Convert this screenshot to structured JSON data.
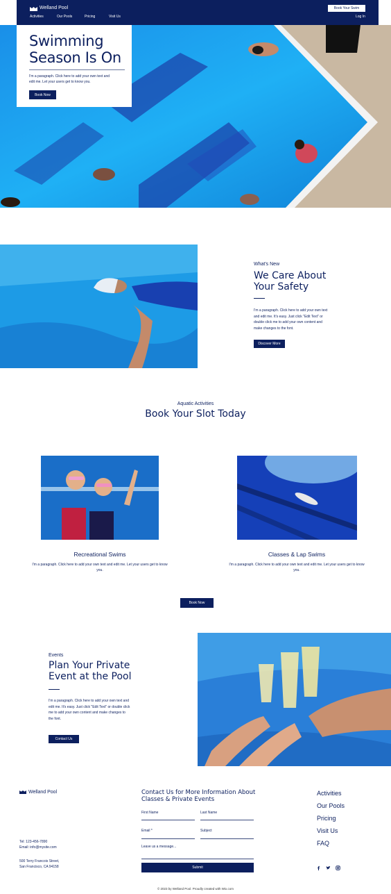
{
  "header": {
    "logo_text": "Welland Pool",
    "nav": [
      "Activities",
      "Our Pools",
      "Pricing",
      "Visit Us"
    ],
    "cta": "Book Your Swim",
    "login": "Log In"
  },
  "hero": {
    "title": "Swimming Season Is On",
    "paragraph": "I'm a paragraph. Click here to add your own text and edit me. Let your users get to know you.",
    "button": "Book Now"
  },
  "safety": {
    "eyebrow": "What's New",
    "title": "We Care About Your Safety",
    "paragraph": "I'm a paragraph. Click here to add your own text and edit me. It's easy. Just click \"Edit Text\" or double click me to add your own content and make changes to the font.",
    "button": "Discover More"
  },
  "activities": {
    "eyebrow": "Aquatic Activities",
    "title": "Book Your Slot Today",
    "cards": [
      {
        "title": "Recreational Swims",
        "paragraph": "I'm a paragraph. Click here to add your own text and edit me. Let your users get to know you."
      },
      {
        "title": "Classes & Lap Swims",
        "paragraph": "I'm a paragraph. Click here to add your own text and edit me. Let your users get to know you."
      }
    ],
    "button": "Book Now"
  },
  "events": {
    "eyebrow": "Events",
    "title": "Plan Your Private Event at the Pool",
    "paragraph": "I'm a paragraph. Click here to add your own text and edit me. It's easy. Just click \"Edit Text\" or double click me to add your own content and make changes to the font.",
    "button": "Contact Us"
  },
  "footer": {
    "logo_text": "Welland Pool",
    "tel": "Tel: 123-456-7890",
    "email": "Email: info@mysite.com",
    "address_1": "500 Terry Francois Street,",
    "address_2": "San Francisco, CA 94158",
    "contact_title": "Contact Us for More Information About Classes & Private Events",
    "form": {
      "first_name": "First Name",
      "last_name": "Last Name",
      "email": "Email *",
      "subject": "Subject",
      "message": "Leave us a message...",
      "submit": "Submit"
    },
    "links": [
      "Activities",
      "Our Pools",
      "Pricing",
      "Visit Us",
      "FAQ"
    ],
    "social_icons": [
      "facebook-icon",
      "twitter-icon",
      "instagram-icon"
    ],
    "copyright": "© 2023 by Welland Pool. Proudly created with Wix.com"
  },
  "colors": {
    "navy": "#0c1f5e",
    "pool_blue": "#1aa0f0",
    "white": "#ffffff"
  }
}
